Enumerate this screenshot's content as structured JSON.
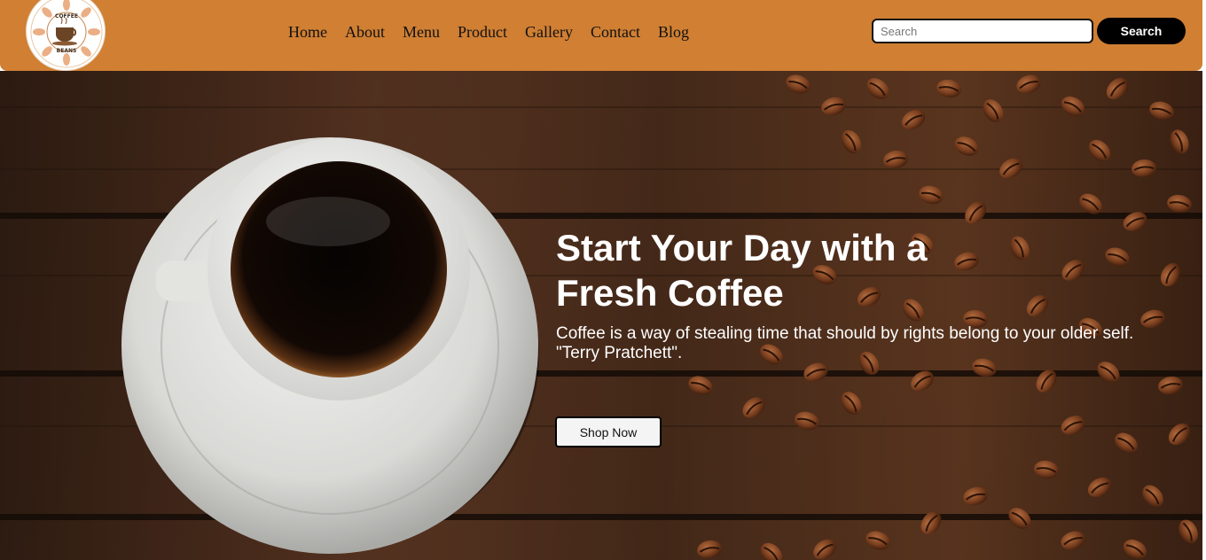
{
  "brand": {
    "logo_text_top": "COFFEE",
    "logo_text_bottom": "BEANS"
  },
  "nav": {
    "items": [
      {
        "label": "Home"
      },
      {
        "label": "About"
      },
      {
        "label": "Menu"
      },
      {
        "label": "Product"
      },
      {
        "label": "Gallery"
      },
      {
        "label": "Contact"
      },
      {
        "label": "Blog"
      }
    ]
  },
  "search": {
    "placeholder": "Search",
    "value": "",
    "button_label": "Search"
  },
  "hero": {
    "title_line1": "Start Your Day with a",
    "title_line2": "Fresh Coffee",
    "quote_line1": "Coffee is a way of stealing time that should by rights belong to your older self.",
    "quote_line2": "\"Terry Pratchett\".",
    "cta_label": "Shop Now"
  },
  "colors": {
    "header_bg": "#d07f33",
    "search_button_bg": "#000000",
    "hero_text": "#ffffff",
    "wood": "#4a2c1b",
    "bean": "#7a3f1f"
  },
  "icons": {
    "logo": "coffee-cup-logo-icon"
  }
}
